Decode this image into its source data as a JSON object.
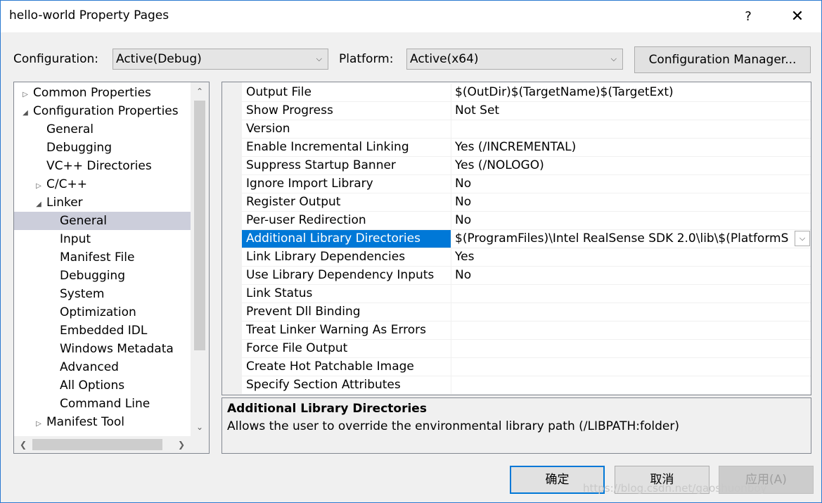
{
  "window": {
    "title": "hello-world Property Pages",
    "help_glyph": "?",
    "close_glyph": "✕"
  },
  "toolbar": {
    "configuration_label": "Configuration:",
    "configuration_value": "Active(Debug)",
    "platform_label": "Platform:",
    "platform_value": "Active(x64)",
    "config_manager_label": "Configuration Manager..."
  },
  "tree": {
    "items": [
      {
        "label": "Common Properties",
        "level": 0,
        "expander": "collapsed"
      },
      {
        "label": "Configuration Properties",
        "level": 0,
        "expander": "expanded"
      },
      {
        "label": "General",
        "level": 1,
        "expander": "none"
      },
      {
        "label": "Debugging",
        "level": 1,
        "expander": "none"
      },
      {
        "label": "VC++ Directories",
        "level": 1,
        "expander": "none"
      },
      {
        "label": "C/C++",
        "level": 1,
        "expander": "collapsed"
      },
      {
        "label": "Linker",
        "level": 1,
        "expander": "expanded"
      },
      {
        "label": "General",
        "level": 2,
        "expander": "none",
        "selected": true
      },
      {
        "label": "Input",
        "level": 2,
        "expander": "none"
      },
      {
        "label": "Manifest File",
        "level": 2,
        "expander": "none"
      },
      {
        "label": "Debugging",
        "level": 2,
        "expander": "none"
      },
      {
        "label": "System",
        "level": 2,
        "expander": "none"
      },
      {
        "label": "Optimization",
        "level": 2,
        "expander": "none"
      },
      {
        "label": "Embedded IDL",
        "level": 2,
        "expander": "none"
      },
      {
        "label": "Windows Metadata",
        "level": 2,
        "expander": "none"
      },
      {
        "label": "Advanced",
        "level": 2,
        "expander": "none"
      },
      {
        "label": "All Options",
        "level": 2,
        "expander": "none"
      },
      {
        "label": "Command Line",
        "level": 2,
        "expander": "none"
      },
      {
        "label": "Manifest Tool",
        "level": 1,
        "expander": "collapsed"
      }
    ]
  },
  "grid": {
    "rows": [
      {
        "name": "Output File",
        "value": "$(OutDir)$(TargetName)$(TargetExt)"
      },
      {
        "name": "Show Progress",
        "value": "Not Set"
      },
      {
        "name": "Version",
        "value": ""
      },
      {
        "name": "Enable Incremental Linking",
        "value": "Yes (/INCREMENTAL)"
      },
      {
        "name": "Suppress Startup Banner",
        "value": "Yes (/NOLOGO)"
      },
      {
        "name": "Ignore Import Library",
        "value": "No"
      },
      {
        "name": "Register Output",
        "value": "No"
      },
      {
        "name": "Per-user Redirection",
        "value": "No"
      },
      {
        "name": "Additional Library Directories",
        "value": "$(ProgramFiles)\\Intel RealSense SDK 2.0\\lib\\$(PlatformS",
        "selected": true
      },
      {
        "name": "Link Library Dependencies",
        "value": "Yes"
      },
      {
        "name": "Use Library Dependency Inputs",
        "value": "No"
      },
      {
        "name": "Link Status",
        "value": ""
      },
      {
        "name": "Prevent Dll Binding",
        "value": ""
      },
      {
        "name": "Treat Linker Warning As Errors",
        "value": ""
      },
      {
        "name": "Force File Output",
        "value": ""
      },
      {
        "name": "Create Hot Patchable Image",
        "value": ""
      },
      {
        "name": "Specify Section Attributes",
        "value": ""
      }
    ]
  },
  "description": {
    "title": "Additional Library Directories",
    "text": "Allows the user to override the environmental library path (/LIBPATH:folder)"
  },
  "buttons": {
    "ok": "确定",
    "cancel": "取消",
    "apply": "应用(A)"
  },
  "watermark": "https://blog.csdn.net/gaoshuonboy",
  "colors": {
    "selection": "#0078d7",
    "tree_selection": "#cccedb",
    "window_border": "#2b79d0"
  }
}
